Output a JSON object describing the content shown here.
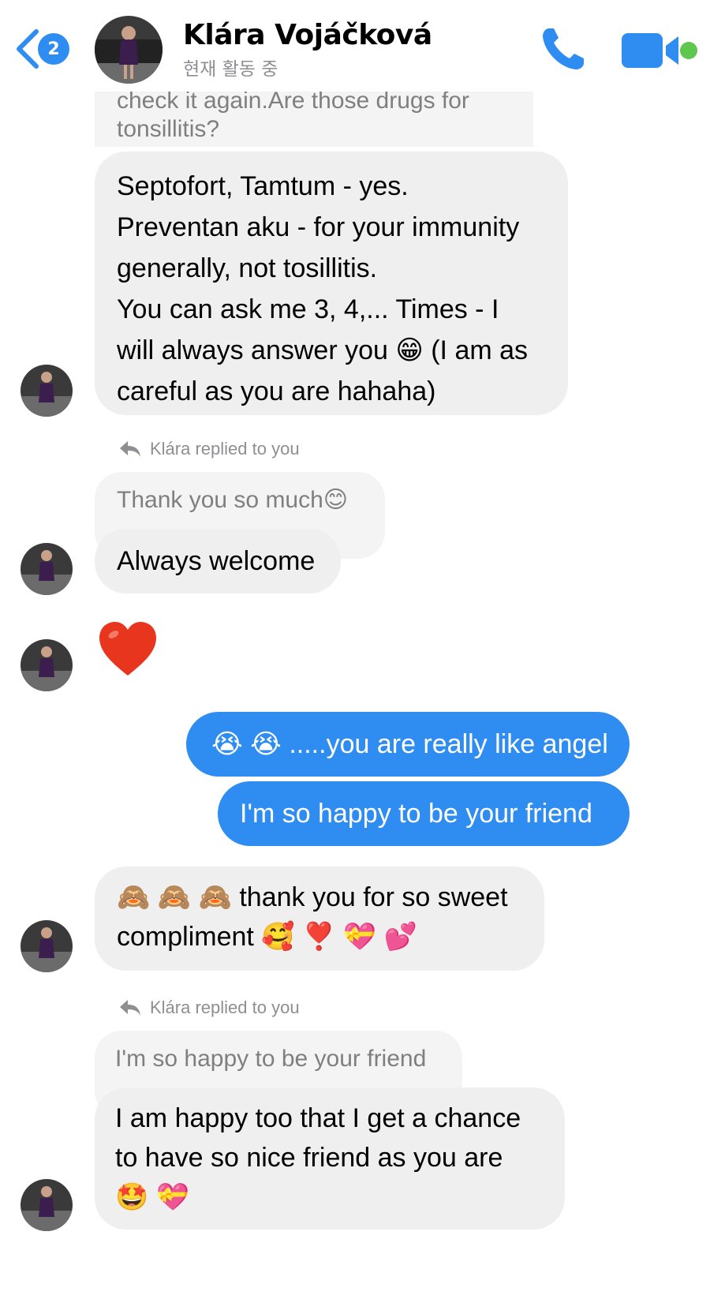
{
  "header": {
    "back_count": "2",
    "name": "Klára Vojáčková",
    "status": "현재 활동 중"
  },
  "messages": {
    "partial_quote": "check it again.Are those drugs for tonsillitis?",
    "m1": [
      "Septofort, Tamtum - yes.",
      "Preventan aku - for your immunity",
      "generally, not tosillitis.",
      "You can ask me 3, 4,... Times - I",
      "will always answer you 😁  (I am as",
      "careful as you are hahaha)"
    ],
    "reply1_label": "Klára replied to you",
    "reply1_quote": "Thank you so much😊",
    "m2": "Always welcome",
    "m3": "❤️",
    "mine1": "😭 😭 .....you are really like angel",
    "mine2": "I'm so happy to be your friend",
    "m4": [
      "🙈 🙈 🙈 thank you for so sweet",
      "compliment 🥰 ❣️ 💝 💕"
    ],
    "reply2_label": "Klára replied to you",
    "reply2_quote": "I'm so happy to be your friend",
    "m5": [
      "I am happy too that I get a chance",
      "to have so nice friend as you are",
      "🤩 💝"
    ]
  },
  "colors": {
    "accent": "#2f8cf1",
    "incoming_bubble": "#efefef",
    "online": "#5ec74d"
  },
  "icons": [
    "chevron-left-icon",
    "phone-icon",
    "video-camera-icon",
    "reply-arrow-icon"
  ]
}
